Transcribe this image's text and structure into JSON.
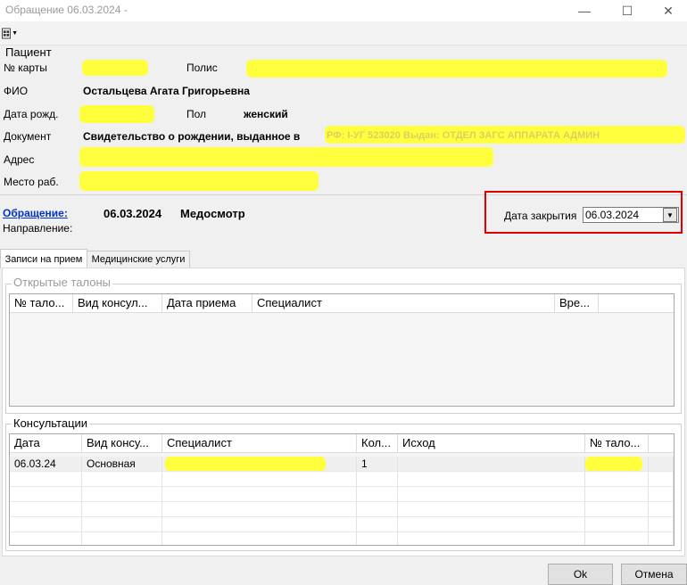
{
  "window": {
    "title": "Обращение 06.03.2024 -"
  },
  "patient": {
    "section_label": "Пациент",
    "card_label": "№ карты",
    "policy_label": "Полис",
    "fio_label": "ФИО",
    "fio_value": "Остальцева Агата Григорьевна",
    "dob_label": "Дата рожд.",
    "sex_label": "Пол",
    "sex_value": "женский",
    "doc_label": "Документ",
    "doc_value": "Свидетельство о рождении, выданное в",
    "doc_value_tail": "РФ: I-УГ 523020 Выдан: ОТДЕЛ ЗАГС АППАРАТА АДМИН",
    "address_label": "Адрес",
    "work_label": "Место раб."
  },
  "visit": {
    "link_label": "Обращение:",
    "date": "06.03.2024",
    "type": "Медосмотр",
    "direction_label": "Направление:",
    "close_date_label": "Дата закрытия",
    "close_date_value": "06.03.2024"
  },
  "tabs": [
    {
      "label": "Записи на прием"
    },
    {
      "label": "Медицинские услуги"
    }
  ],
  "open_tickets": {
    "title": "Открытые талоны",
    "columns": [
      "№ тало...",
      "Вид консул...",
      "Дата приема",
      "Специалист",
      "Вре...",
      ""
    ]
  },
  "consultations": {
    "title": "Консультации",
    "columns": [
      "Дата",
      "Вид консу...",
      "Специалист",
      "Кол...",
      "Исход",
      "№ тало...",
      ""
    ],
    "rows": [
      {
        "date": "06.03.24",
        "kind": "Основная",
        "specialist": "",
        "count": "1",
        "outcome": "",
        "ticket": ""
      }
    ]
  },
  "buttons": {
    "ok": "Ok",
    "cancel": "Отмена"
  }
}
